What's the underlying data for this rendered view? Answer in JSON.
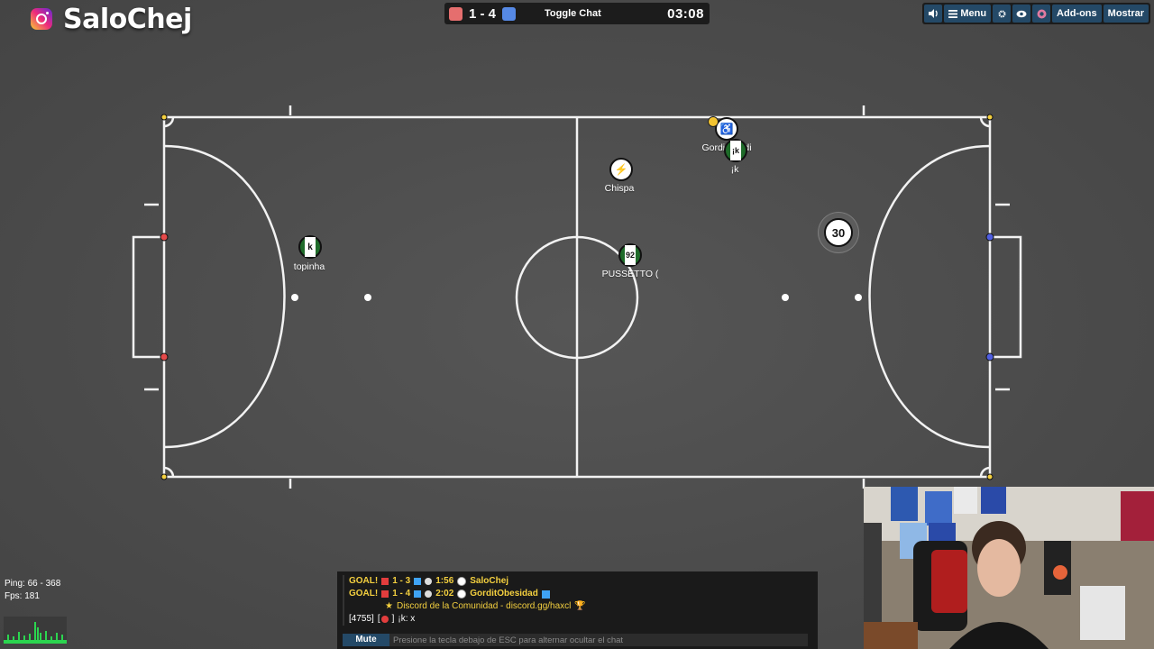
{
  "logo": {
    "text": "SaloChej",
    "icon": "instagram-icon"
  },
  "scoreboard": {
    "red_color": "#e56e6e",
    "blue_color": "#5689e5",
    "score": "1 - 4",
    "toggle_chat": "Toggle Chat",
    "timer": "03:08"
  },
  "toolbar": {
    "sound_icon": "speaker-icon",
    "menu_label": "Menu",
    "menu_icon": "hamburger-icon",
    "settings_icon": "gear-icon",
    "view_icon": "eye-icon",
    "avatar_icon": "avatar-icon",
    "addons_label": "Add-ons",
    "show_label": "Mostrar"
  },
  "players": [
    {
      "name": "topinha",
      "avatar": "k",
      "team": "red"
    },
    {
      "name": "Chispa",
      "avatar": "⚡",
      "team": "neutral"
    },
    {
      "name": "PUSSETTO (",
      "avatar": "92",
      "team": "red"
    },
    {
      "name": "Gordit",
      "name_tail": "idi",
      "avatar": "♿",
      "team": "blue"
    },
    {
      "name": "¡k",
      "avatar": "¡k",
      "team": "red"
    }
  ],
  "ball": {
    "label": "30"
  },
  "stats": {
    "ping": "Ping: 66 - 368",
    "fps": "Fps: 181"
  },
  "chat": {
    "lines": [
      {
        "type": "goal",
        "label": "GOAL!",
        "score": "1 - 3",
        "time": "1:56",
        "player": "SaloChej"
      },
      {
        "type": "goal",
        "label": "GOAL!",
        "score": "1 - 4",
        "time": "2:02",
        "player": "GorditObesidad"
      }
    ],
    "discord": "Discord de la Comunidad - discord.gg/haxcl",
    "message_id": "[4755]",
    "message_bracket": "[",
    "message_close": "]",
    "message_text": "¡k: x",
    "mute_label": "Mute",
    "placeholder": "Presione la tecla debajo de ESC para alternar ocultar el chat"
  }
}
